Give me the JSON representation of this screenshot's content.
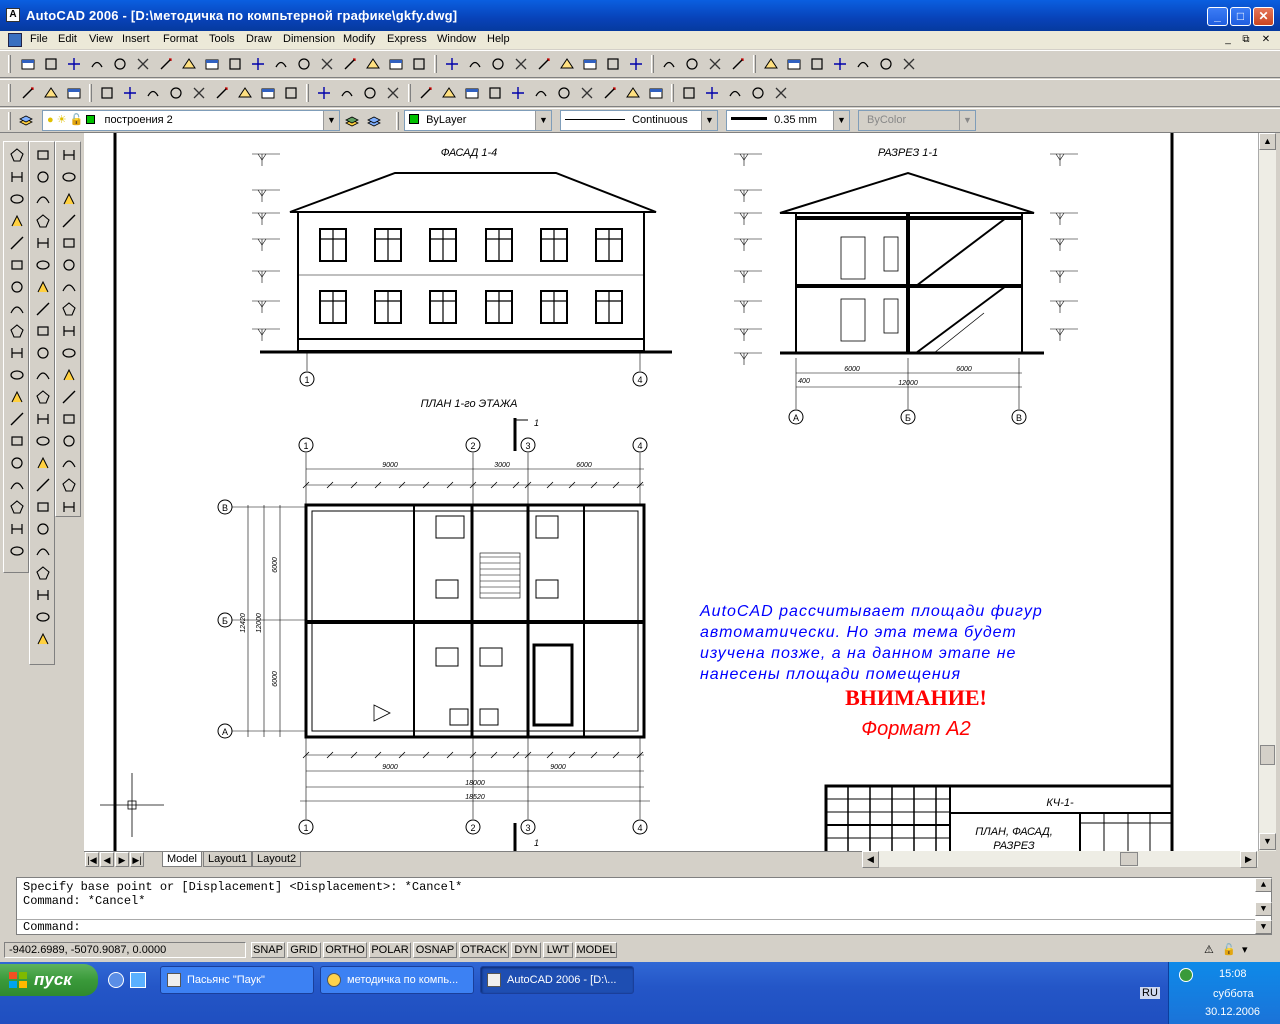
{
  "window": {
    "title": "AutoCAD 2006 - [D:\\методичка по компьтерной графике\\gkfy.dwg]",
    "app_icon": "autocad-icon",
    "minimize": "_",
    "maximize": "□",
    "close": "✕"
  },
  "menu": {
    "items": [
      "File",
      "Edit",
      "View",
      "Insert",
      "Format",
      "Tools",
      "Draw",
      "Dimension",
      "Modify",
      "Express",
      "Window",
      "Help"
    ],
    "doc_minimize": "_",
    "doc_restore": "⧉",
    "doc_close": "✕"
  },
  "properties": {
    "layer": "построения 2",
    "color": "ByLayer",
    "linetype": "Continuous",
    "lineweight": "0.35 mm",
    "plotstyle": "ByColor",
    "color_swatch": "#00c000"
  },
  "drawing": {
    "facade_title": "ФАСАД 1-4",
    "section_title": "РАЗРЕЗ 1-1",
    "plan_title": "ПЛАН 1-го ЭТАЖА",
    "note_text": "AutoCAD рассчитывает площади фигур автоматически. Но эта тема будет изучена позже, а на данном этапе не нанесены площади помещения",
    "warning": "ВНИМАНИЕ!",
    "format": "Формат А2",
    "stamp_code": "КЧ-1-",
    "stamp_title_1": "ПЛАН, ФАСАД,",
    "stamp_title_2": "РАЗРЕЗ",
    "note_color": "#0000ff",
    "warning_color": "#ff0000",
    "axis_labels": {
      "a1": "1",
      "a2": "2",
      "a3": "3",
      "a4": "4",
      "ra": "А",
      "rb": "Б",
      "rv": "В"
    },
    "section_axes": {
      "a": "А",
      "b": "Б",
      "v": "В"
    },
    "dims": {
      "d9000": "9000",
      "d3000": "3000",
      "d6000": "6000",
      "d18000": "18000",
      "d18520": "18520",
      "d12000": "12000",
      "d12420": "12420",
      "d400": "400",
      "d1": "1"
    }
  },
  "tabs": [
    "Model",
    "Layout1",
    "Layout2"
  ],
  "command": {
    "line1": "Specify base point or [Displacement] <Displacement>: *Cancel*",
    "line2": "Command: *Cancel*",
    "prompt": "Command:"
  },
  "status": {
    "coords": "-9402.6989, -5070.9087, 0.0000",
    "buttons": [
      "SNAP",
      "GRID",
      "ORTHO",
      "POLAR",
      "OSNAP",
      "OTRACK",
      "DYN",
      "LWT",
      "MODEL"
    ]
  },
  "taskbar": {
    "start": "пуск",
    "tasks": [
      "Пасьянс \"Паук\"",
      "методичка по компь...",
      "AutoCAD 2006 - [D:\\..."
    ],
    "lang": "RU",
    "time": "15:08",
    "day": "суббота",
    "date": "30.12.2006"
  }
}
